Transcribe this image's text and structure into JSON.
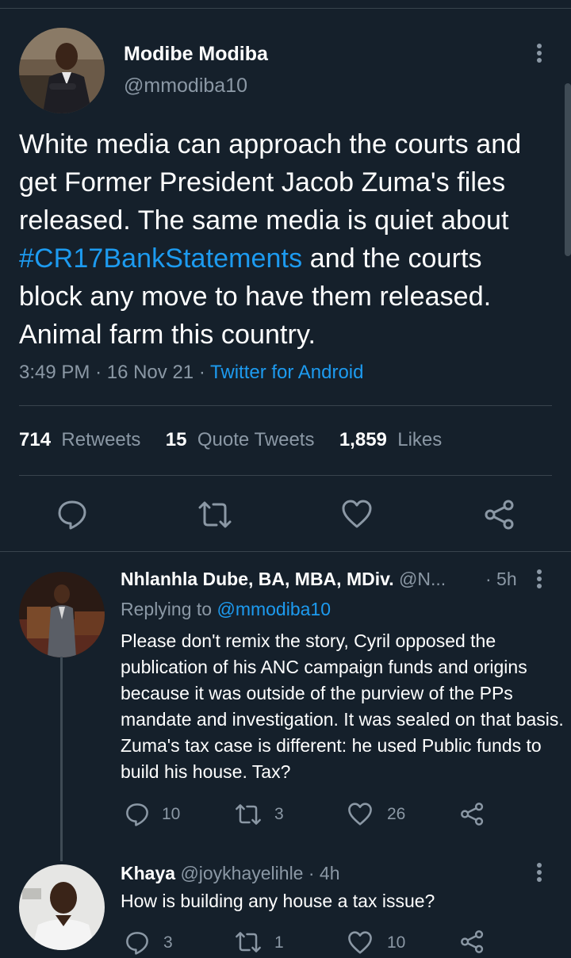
{
  "main_tweet": {
    "author_name": "Modibe Modiba",
    "author_handle": "@mmodiba10",
    "text_before_tag": "White media can approach the courts and get Former President Jacob Zuma's files released. The same media is quiet about ",
    "hashtag": "#CR17BankStatements",
    "text_after_tag": " and the courts block any move to have them released. Animal farm this country.",
    "time": "3:49 PM",
    "separator": "·",
    "date": "16 Nov 21",
    "source": "Twitter for Android",
    "retweets_count": "714",
    "retweets_label": "Retweets",
    "quotes_count": "15",
    "quotes_label": "Quote Tweets",
    "likes_count": "1,859",
    "likes_label": "Likes"
  },
  "replies": [
    {
      "author_name": "Nhlanhla Dube, BA, MBA, MDiv.",
      "author_handle": "@N...",
      "time": "· 5h",
      "replying_label": "Replying to",
      "replying_handle": "@mmodiba10",
      "text": "Please don't remix the story, Cyril opposed the publication of his ANC campaign funds and origins because it was outside of the purview of the PPs mandate and investigation. It was sealed on that basis.  Zuma's tax case is different: he used Public funds to build his house. Tax?",
      "reply_count": "10",
      "retweet_count": "3",
      "like_count": "26"
    },
    {
      "author_name": "Khaya",
      "author_handle": "@joykhayelihle",
      "time": "· 4h",
      "text": "How is building any house a tax issue?",
      "reply_count": "3",
      "retweet_count": "1",
      "like_count": "10"
    }
  ],
  "colors": {
    "background": "#15202b",
    "accent": "#1d9bf0",
    "muted": "#8b98a5",
    "divider": "#38444d"
  },
  "icons": [
    "more-vertical-icon",
    "reply-icon",
    "retweet-icon",
    "like-icon",
    "share-icon"
  ]
}
